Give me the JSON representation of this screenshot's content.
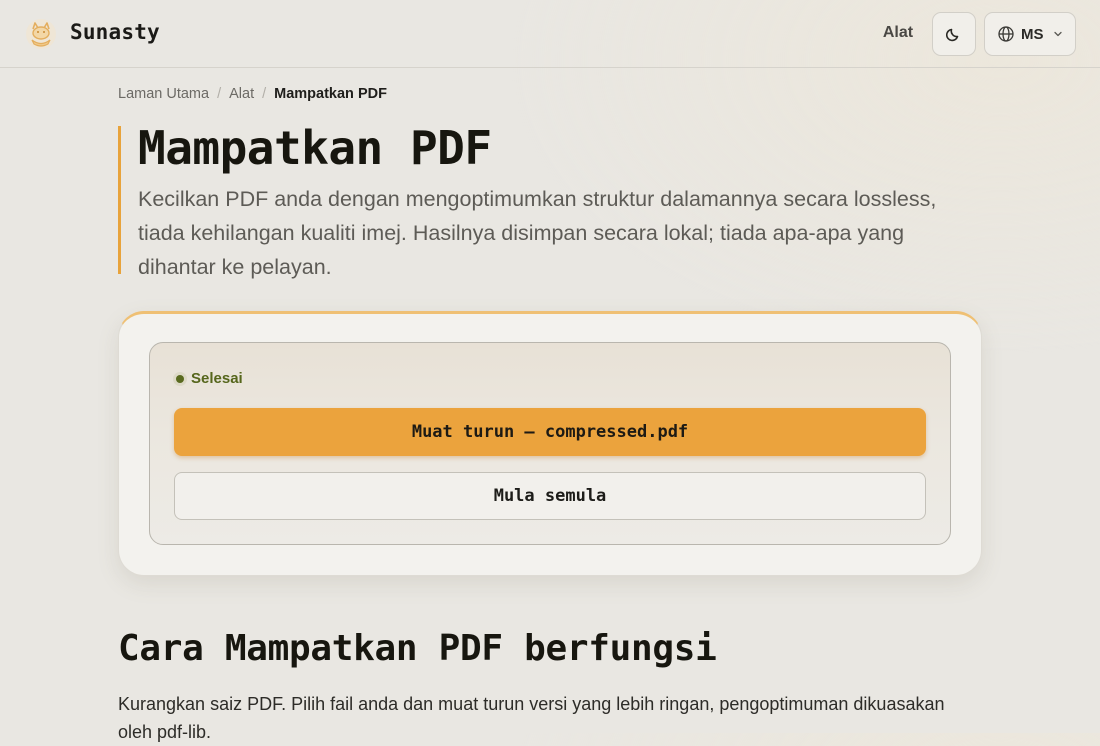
{
  "header": {
    "brand": "Sunasty",
    "nav_tools": "Alat",
    "language": "MS"
  },
  "breadcrumb": {
    "home": "Laman Utama",
    "tools": "Alat",
    "current": "Mampatkan PDF"
  },
  "page": {
    "title": "Mampatkan PDF",
    "description": "Kecilkan PDF anda dengan mengoptimumkan struktur dalamannya secara lossless, tiada kehilangan kualiti imej. Hasilnya disimpan secara lokal; tiada apa-apa yang dihantar ke pelayan."
  },
  "result": {
    "status": "Selesai",
    "download_label": "Muat turun — compressed.pdf",
    "reset_label": "Mula semula"
  },
  "how_it_works": {
    "heading": "Cara Mampatkan PDF berfungsi",
    "text": "Kurangkan saiz PDF. Pilih fail anda dan muat turun versi yang lebih ringan, pengoptimuman dikuasakan oleh pdf-lib."
  },
  "colors": {
    "accent": "#eba33d",
    "accent_border": "#e8a33b",
    "status_green": "#56661c",
    "background": "#e9e7e2"
  },
  "icons": {
    "logo": "cat-logo-icon",
    "theme": "moon-icon",
    "language": "globe-icon",
    "dropdown": "chevron-down-icon"
  }
}
